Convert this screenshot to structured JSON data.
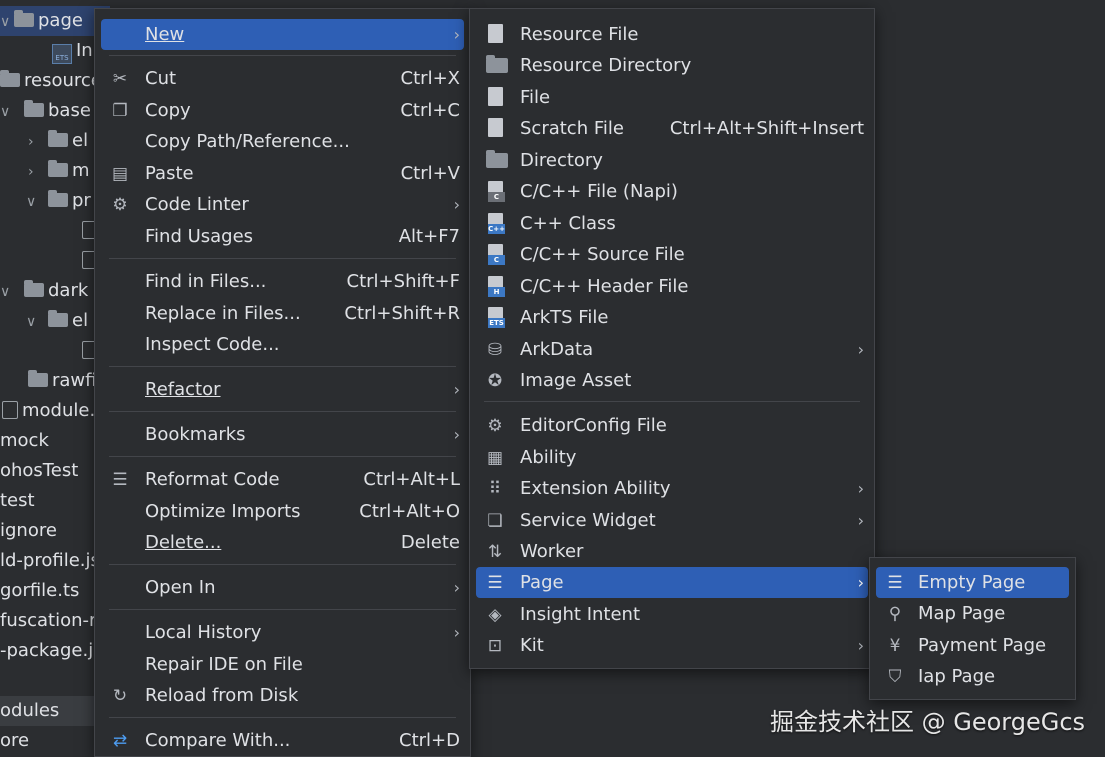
{
  "tree": {
    "rows": [
      {
        "label": "page",
        "kind": "folder",
        "chev": "∨"
      },
      {
        "label": "In",
        "kind": "ets"
      },
      {
        "label": "resource",
        "kind": "folder"
      },
      {
        "label": "base",
        "kind": "folder",
        "chev": "∨"
      },
      {
        "label": "el",
        "kind": "folder",
        "chev": "›"
      },
      {
        "label": "m",
        "kind": "folder",
        "chev": "›"
      },
      {
        "label": "pr",
        "kind": "folder",
        "chev": "∨"
      },
      {
        "label": "",
        "kind": "file"
      },
      {
        "label": "",
        "kind": "file"
      },
      {
        "label": "dark",
        "kind": "folder",
        "chev": "∨"
      },
      {
        "label": "el",
        "kind": "folder",
        "chev": "∨"
      },
      {
        "label": "",
        "kind": "file"
      },
      {
        "label": "rawfi",
        "kind": "folder"
      },
      {
        "label": "module.",
        "kind": "file"
      },
      {
        "label": "mock",
        "kind": "text"
      },
      {
        "label": "ohosTest",
        "kind": "text"
      },
      {
        "label": "test",
        "kind": "text"
      },
      {
        "label": "ignore",
        "kind": "text"
      },
      {
        "label": "ld-profile.js",
        "kind": "text"
      },
      {
        "label": "gorfile.ts",
        "kind": "text"
      },
      {
        "label": "fuscation-ru",
        "kind": "text"
      },
      {
        "label": "-package.jso",
        "kind": "text"
      },
      {
        "label": "",
        "kind": "text"
      },
      {
        "label": "odules",
        "kind": "text"
      },
      {
        "label": "ore",
        "kind": "text"
      }
    ]
  },
  "menu_main": {
    "new": {
      "label": "New",
      "arrow": "›"
    },
    "cut": {
      "label": "Cut",
      "shortcut": "Ctrl+X"
    },
    "copy": {
      "label": "Copy",
      "shortcut": "Ctrl+C"
    },
    "copy_path": {
      "label": "Copy Path/Reference..."
    },
    "paste": {
      "label": "Paste",
      "shortcut": "Ctrl+V"
    },
    "code_linter": {
      "label": "Code Linter",
      "arrow": "›"
    },
    "find_usages": {
      "label": "Find Usages",
      "shortcut": "Alt+F7"
    },
    "find_in_files": {
      "label": "Find in Files...",
      "shortcut": "Ctrl+Shift+F"
    },
    "replace_in_files": {
      "label": "Replace in Files...",
      "shortcut": "Ctrl+Shift+R"
    },
    "inspect_code": {
      "label": "Inspect Code..."
    },
    "refactor": {
      "label": "Refactor",
      "arrow": "›"
    },
    "bookmarks": {
      "label": "Bookmarks",
      "arrow": "›"
    },
    "reformat": {
      "label": "Reformat Code",
      "shortcut": "Ctrl+Alt+L"
    },
    "optimize": {
      "label": "Optimize Imports",
      "shortcut": "Ctrl+Alt+O"
    },
    "delete": {
      "label": "Delete...",
      "shortcut": "Delete"
    },
    "open_in": {
      "label": "Open In",
      "arrow": "›"
    },
    "local_history": {
      "label": "Local History",
      "arrow": "›"
    },
    "repair_ide": {
      "label": "Repair IDE on File"
    },
    "reload": {
      "label": "Reload from Disk"
    },
    "compare": {
      "label": "Compare With...",
      "shortcut": "Ctrl+D"
    }
  },
  "menu_new": {
    "resource_file": {
      "label": "Resource File"
    },
    "resource_directory": {
      "label": "Resource Directory"
    },
    "file": {
      "label": "File"
    },
    "scratch_file": {
      "label": "Scratch File",
      "shortcut": "Ctrl+Alt+Shift+Insert"
    },
    "directory": {
      "label": "Directory"
    },
    "napi": {
      "label": "C/C++ File (Napi)"
    },
    "cpp_class": {
      "label": "C++ Class"
    },
    "cpp_source": {
      "label": "C/C++ Source File"
    },
    "cpp_header": {
      "label": "C/C++ Header File"
    },
    "arkts": {
      "label": "ArkTS File"
    },
    "arkdata": {
      "label": "ArkData",
      "arrow": "›"
    },
    "image_asset": {
      "label": "Image Asset"
    },
    "editorconfig": {
      "label": "EditorConfig File"
    },
    "ability": {
      "label": "Ability"
    },
    "extension_ability": {
      "label": "Extension Ability",
      "arrow": "›"
    },
    "service_widget": {
      "label": "Service Widget",
      "arrow": "›"
    },
    "worker": {
      "label": "Worker"
    },
    "page": {
      "label": "Page",
      "arrow": "›"
    },
    "insight_intent": {
      "label": "Insight Intent"
    },
    "kit": {
      "label": "Kit",
      "arrow": "›"
    }
  },
  "menu_page": {
    "empty": {
      "label": "Empty Page"
    },
    "map": {
      "label": "Map Page"
    },
    "payment": {
      "label": "Payment Page"
    },
    "iap": {
      "label": "Iap Page"
    }
  },
  "icon_tags": {
    "ets": "ETS",
    "c": "C",
    "cpp": "C++",
    "h": "H"
  },
  "watermark": "掘金技术社区 @ GeorgeGcs",
  "colors": {
    "background": "#2b2d30",
    "highlight": "#2e5fb5",
    "selected_tree": "#2e436e",
    "text": "#dfe1e5"
  }
}
